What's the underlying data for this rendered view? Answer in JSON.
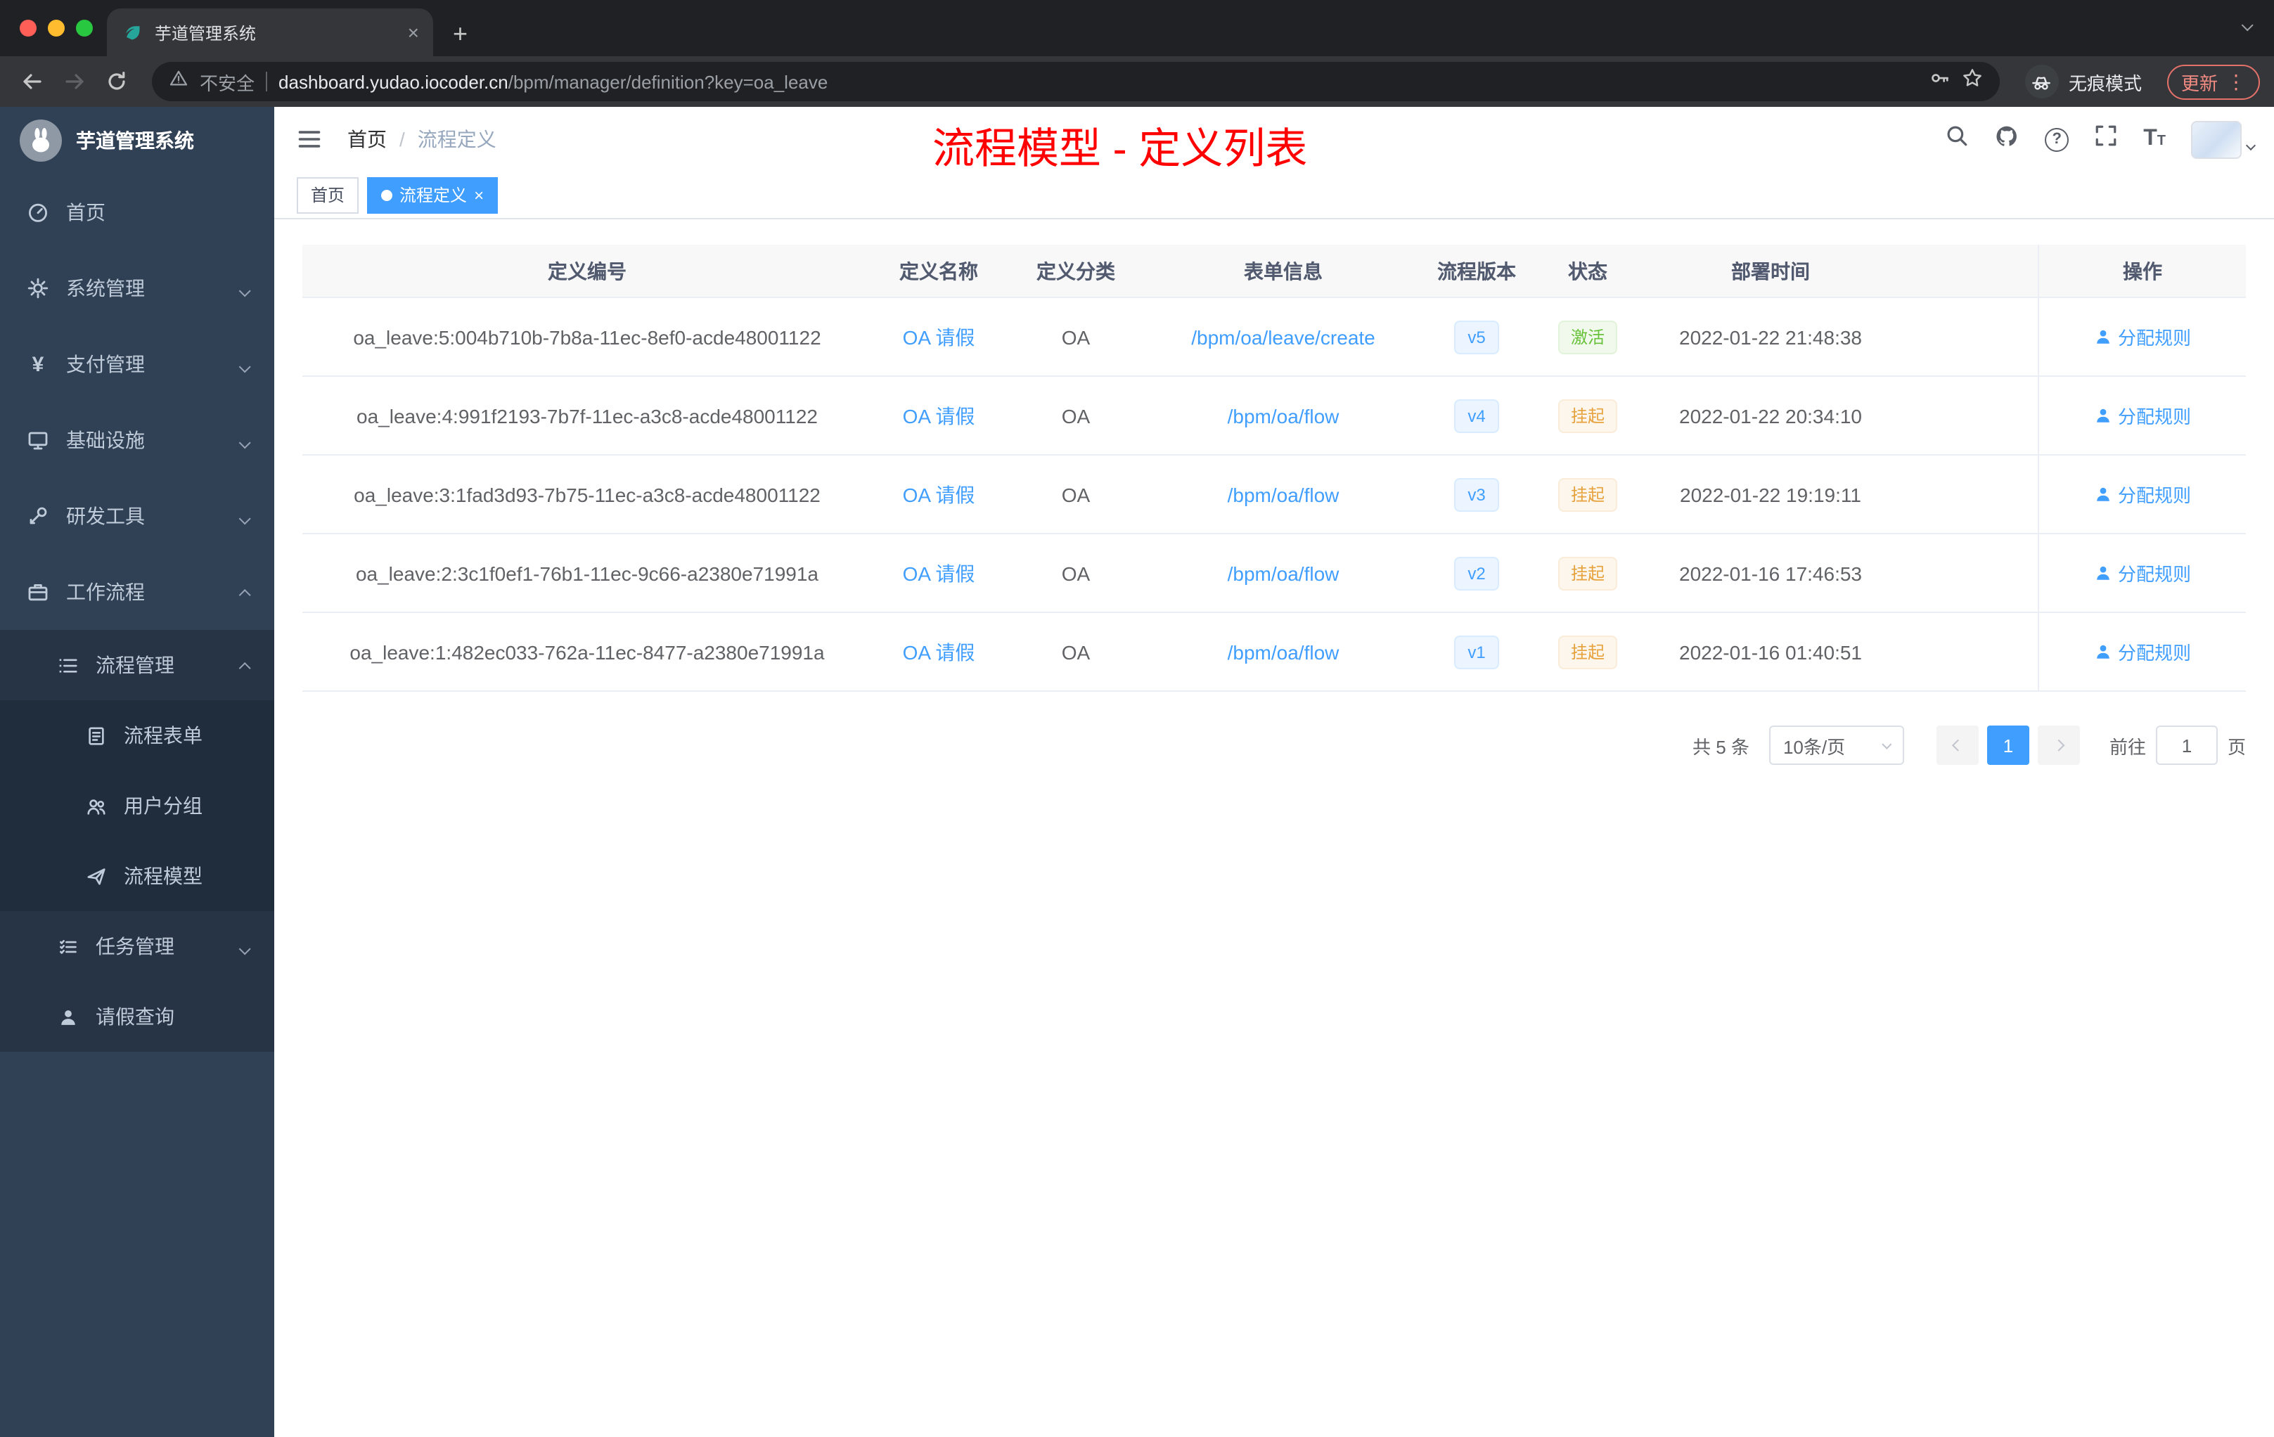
{
  "colors": {
    "accent": "#409eff",
    "success": "#67c23a",
    "warning": "#e6a23c",
    "annotation_red": "#ff0000",
    "sidebar_bg": "#304156"
  },
  "icons": {
    "new_tab": "+",
    "tab_close": "×",
    "menu_overflow": "⋮",
    "yen": "¥",
    "help": "?"
  },
  "browser": {
    "tab_title": "芋道管理系统",
    "security_label": "不安全",
    "url_domain": "dashboard.yudao.iocoder.cn",
    "url_path": "/bpm/manager/definition?key=oa_leave",
    "incognito_label": "无痕模式",
    "update_label": "更新"
  },
  "sidebar": {
    "logo_title": "芋道管理系统",
    "items": [
      {
        "label": "首页"
      },
      {
        "label": "系统管理"
      },
      {
        "label": "支付管理"
      },
      {
        "label": "基础设施"
      },
      {
        "label": "研发工具"
      },
      {
        "label": "工作流程"
      },
      {
        "label": "流程管理"
      },
      {
        "label": "流程表单"
      },
      {
        "label": "用户分组"
      },
      {
        "label": "流程模型"
      },
      {
        "label": "任务管理"
      },
      {
        "label": "请假查询"
      }
    ]
  },
  "header": {
    "breadcrumb_home": "首页",
    "breadcrumb_separator": "/",
    "breadcrumb_current": "流程定义",
    "annotation": "流程模型 - 定义列表"
  },
  "tags": {
    "items": [
      {
        "label": "首页"
      },
      {
        "label": "流程定义"
      }
    ]
  },
  "table": {
    "columns": [
      "定义编号",
      "定义名称",
      "定义分类",
      "表单信息",
      "流程版本",
      "状态",
      "部署时间",
      "操作"
    ],
    "rows": [
      {
        "id": "oa_leave:5:004b710b-7b8a-11ec-8ef0-acde48001122",
        "name": "OA 请假",
        "category": "OA",
        "form": "/bpm/oa/leave/create",
        "version": "v5",
        "status": "激活",
        "status_type": "success",
        "deploy_time": "2022-01-22 21:48:38",
        "action": "分配规则"
      },
      {
        "id": "oa_leave:4:991f2193-7b7f-11ec-a3c8-acde48001122",
        "name": "OA 请假",
        "category": "OA",
        "form": "/bpm/oa/flow",
        "version": "v4",
        "status": "挂起",
        "status_type": "warning",
        "deploy_time": "2022-01-22 20:34:10",
        "action": "分配规则"
      },
      {
        "id": "oa_leave:3:1fad3d93-7b75-11ec-a3c8-acde48001122",
        "name": "OA 请假",
        "category": "OA",
        "form": "/bpm/oa/flow",
        "version": "v3",
        "status": "挂起",
        "status_type": "warning",
        "deploy_time": "2022-01-22 19:19:11",
        "action": "分配规则"
      },
      {
        "id": "oa_leave:2:3c1f0ef1-76b1-11ec-9c66-a2380e71991a",
        "name": "OA 请假",
        "category": "OA",
        "form": "/bpm/oa/flow",
        "version": "v2",
        "status": "挂起",
        "status_type": "warning",
        "deploy_time": "2022-01-16 17:46:53",
        "action": "分配规则"
      },
      {
        "id": "oa_leave:1:482ec033-762a-11ec-8477-a2380e71991a",
        "name": "OA 请假",
        "category": "OA",
        "form": "/bpm/oa/flow",
        "version": "v1",
        "status": "挂起",
        "status_type": "warning",
        "deploy_time": "2022-01-16 01:40:51",
        "action": "分配规则"
      }
    ]
  },
  "pagination": {
    "total": "共 5 条",
    "page_size": "10条/页",
    "current_page": "1",
    "goto_label": "前往",
    "goto_value": "1",
    "page_unit": "页"
  }
}
